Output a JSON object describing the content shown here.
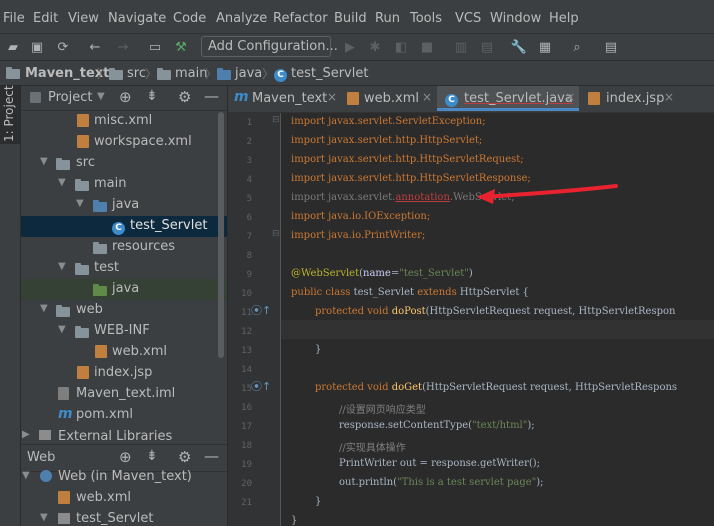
{
  "menu": [
    "File",
    "Edit",
    "View",
    "Navigate",
    "Code",
    "Analyze",
    "Refactor",
    "Build",
    "Run",
    "Tools",
    "VCS",
    "Window",
    "Help"
  ],
  "toolbar": {
    "add_configuration": "Add Configuration..."
  },
  "breadcrumb": [
    "Maven_text",
    "src",
    "main",
    "java",
    "test_Servlet"
  ],
  "left_stripe": {
    "label": "1: Project"
  },
  "project_panel": {
    "title": "Project",
    "tree": [
      {
        "label": "misc.xml"
      },
      {
        "label": "workspace.xml"
      },
      {
        "label": "src"
      },
      {
        "label": "main"
      },
      {
        "label": "java"
      },
      {
        "label": "test_Servlet"
      },
      {
        "label": "resources"
      },
      {
        "label": "test"
      },
      {
        "label": "java"
      },
      {
        "label": "web"
      },
      {
        "label": "WEB-INF"
      },
      {
        "label": "web.xml"
      },
      {
        "label": "index.jsp"
      },
      {
        "label": "Maven_text.iml"
      },
      {
        "label": "pom.xml"
      },
      {
        "label": "External Libraries"
      }
    ]
  },
  "web_panel": {
    "title": "Web",
    "tree": [
      {
        "label": "Web (in Maven_text)"
      },
      {
        "label": "web.xml"
      },
      {
        "label": "test_Servlet"
      }
    ]
  },
  "editor": {
    "tabs": [
      {
        "label": "Maven_text"
      },
      {
        "label": "web.xml"
      },
      {
        "label": "test_Servlet.java"
      },
      {
        "label": "index.jsp"
      }
    ],
    "line_numbers": [
      "1",
      "2",
      "3",
      "4",
      "5",
      "6",
      "7",
      "8",
      "9",
      "10",
      "11",
      "12",
      "13",
      "14",
      "15",
      "16",
      "17",
      "18",
      "19",
      "20",
      "21"
    ],
    "code": {
      "l1": [
        "import javax.servlet.ServletException;"
      ],
      "l2": [
        "import javax.servlet.http.HttpServlet;"
      ],
      "l3": [
        "import javax.servlet.http.HttpServletRequest;"
      ],
      "l4": [
        "import javax.servlet.http.HttpServletResponse;"
      ],
      "l5a": "import javax.servlet.",
      "l5b": "annotation",
      "l5c": ".WebServlet;",
      "l6": "import java.io.IOException;",
      "l7": "import java.io.PrintWriter;",
      "l9a": "@WebServlet",
      "l9b": "(",
      "l9c": "name",
      "l9d": "=",
      "l9e": "\"test_Servlet\"",
      "l9f": ")",
      "l10a": "public class ",
      "l10b": "test_Servlet ",
      "l10c": "extends ",
      "l10d": "HttpServlet {",
      "l11a": "protected void ",
      "l11b": "doPost",
      "l11c": "(HttpServletRequest request, HttpServletRespon",
      "l13": "}",
      "l15a": "protected void ",
      "l15b": "doGet",
      "l15c": "(HttpServletRequest request, HttpServletRespons",
      "l16": "//设置网页响应类型",
      "l17a": "response.setContentType(",
      "l17b": "\"text/html\"",
      "l17c": ");",
      "l18": "//实现具体操作",
      "l19": "PrintWriter out = response.getWriter();",
      "l20a": "out.println(",
      "l20b": "\"This is a test servlet page\"",
      "l20c": ");",
      "l21": "}",
      "l22": "}"
    }
  },
  "colors": {
    "annotation_arrow": "#e8232f",
    "active_tab_underline": "#4a88c7",
    "selection": "#0d293e"
  }
}
